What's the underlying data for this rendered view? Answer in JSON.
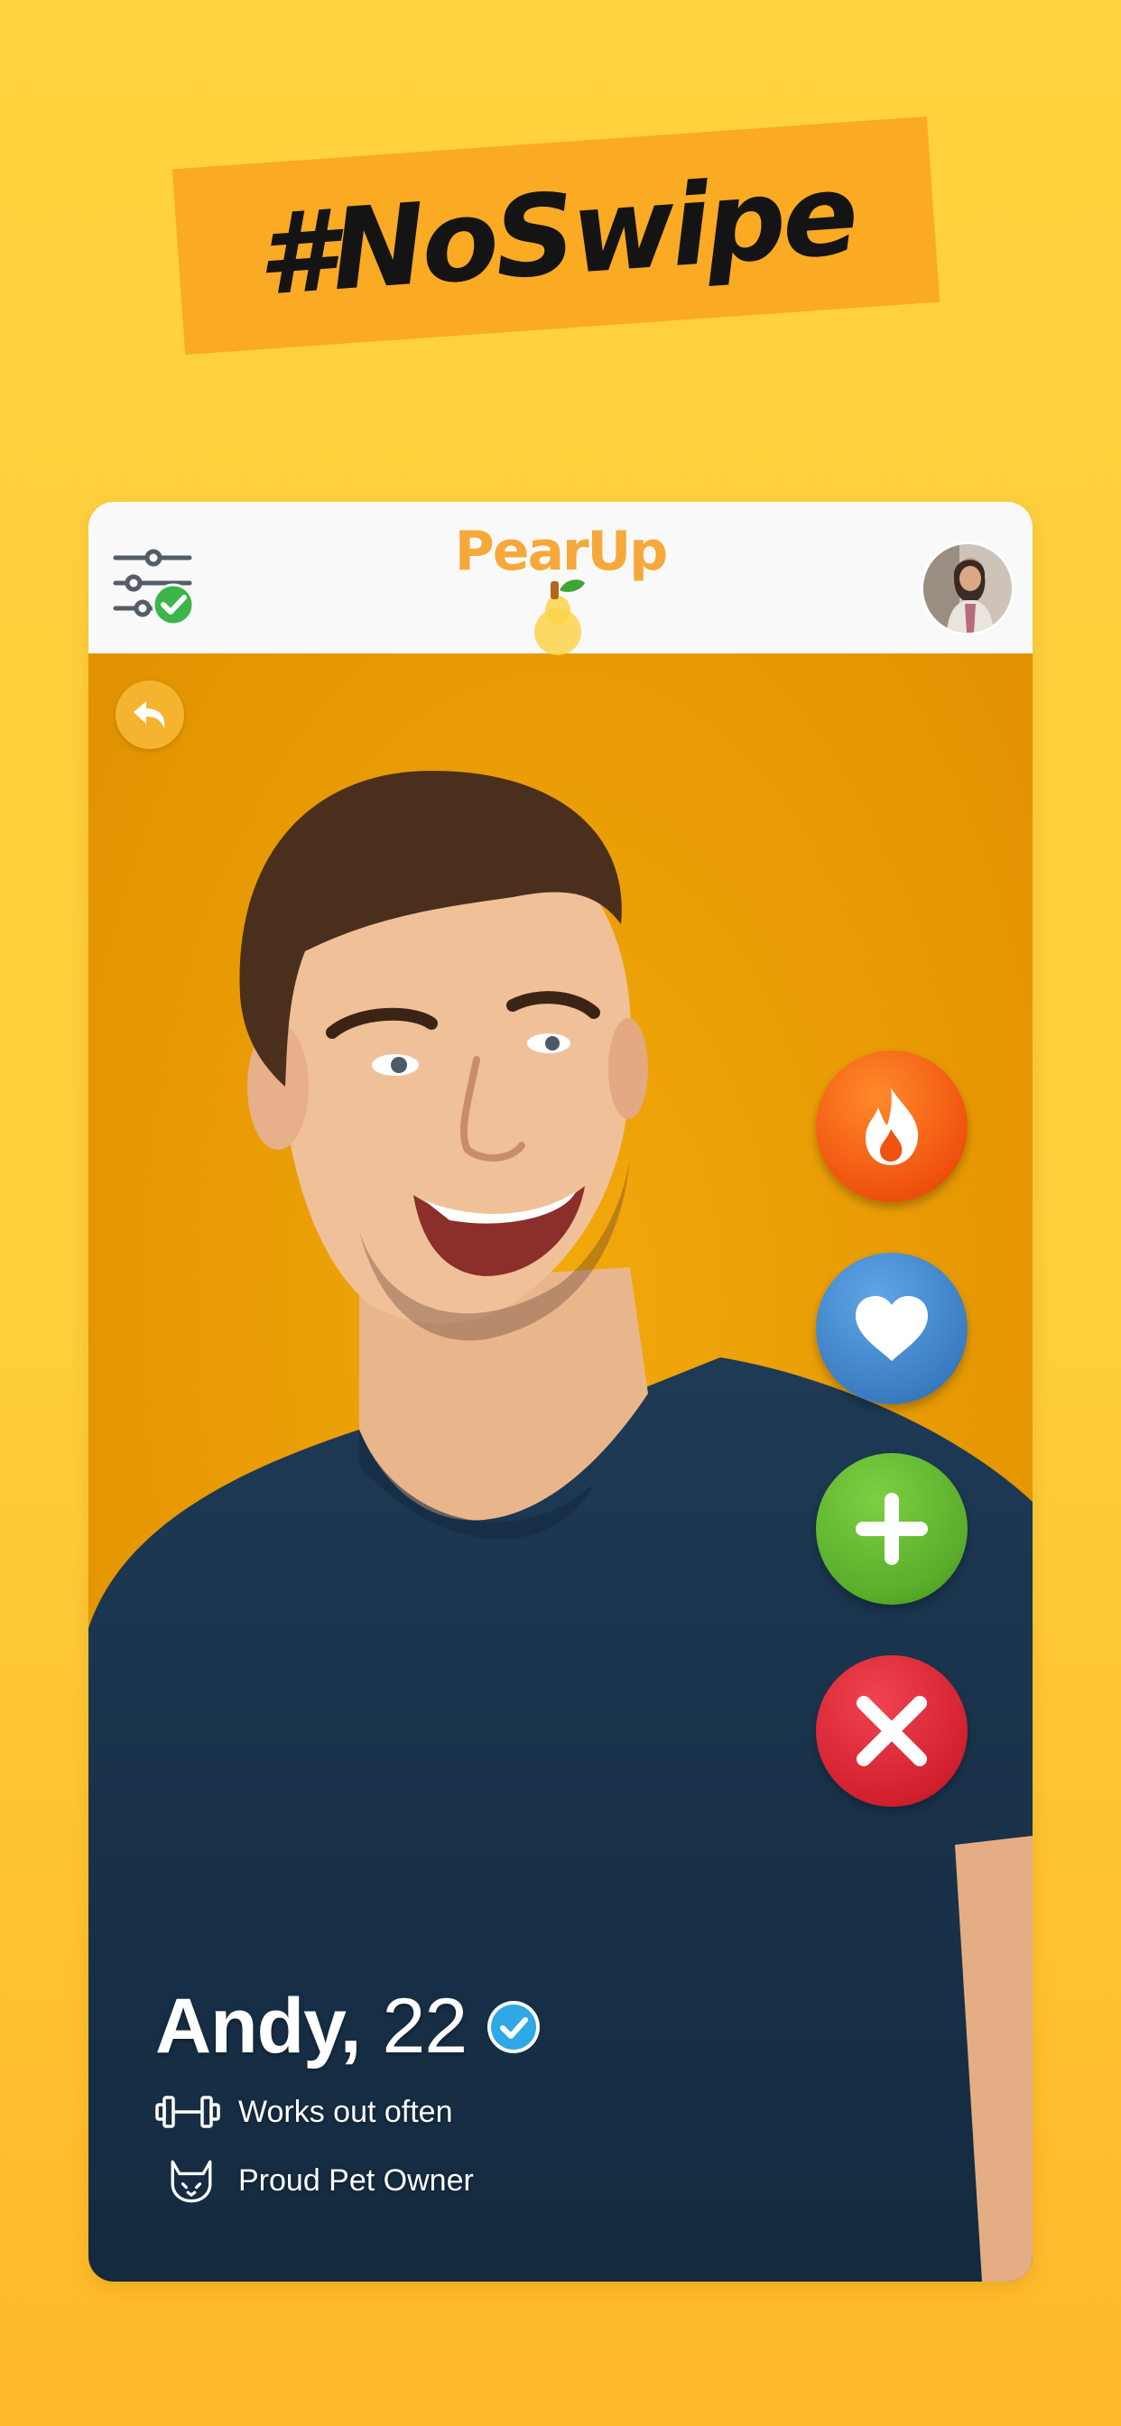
{
  "banner": {
    "text": "#NoSwipe"
  },
  "app": {
    "logo_text": "PearUp"
  },
  "header": {
    "filter_icon": "sliders-check-icon",
    "avatar_icon": "profile-avatar"
  },
  "card": {
    "back_icon": "undo-arrow-icon",
    "actions": [
      {
        "name": "super-like",
        "icon": "fire-icon",
        "color": "#f0520f"
      },
      {
        "name": "like",
        "icon": "heart-icon",
        "color": "#3b7dc2"
      },
      {
        "name": "add",
        "icon": "plus-icon",
        "color": "#58ad2a"
      },
      {
        "name": "pass",
        "icon": "close-icon",
        "color": "#d3202f"
      }
    ],
    "profile": {
      "name": "Andy,",
      "age": "22",
      "verified_icon": "verified-check-icon",
      "traits": [
        {
          "icon": "dumbbell-icon",
          "label": "Works out often"
        },
        {
          "icon": "cat-icon",
          "label": "Proud Pet Owner"
        }
      ]
    }
  },
  "colors": {
    "background": "#ffd23f",
    "banner": "#fbaa24",
    "logo": "#f6a93a",
    "photo_bg": "#e89d07"
  }
}
